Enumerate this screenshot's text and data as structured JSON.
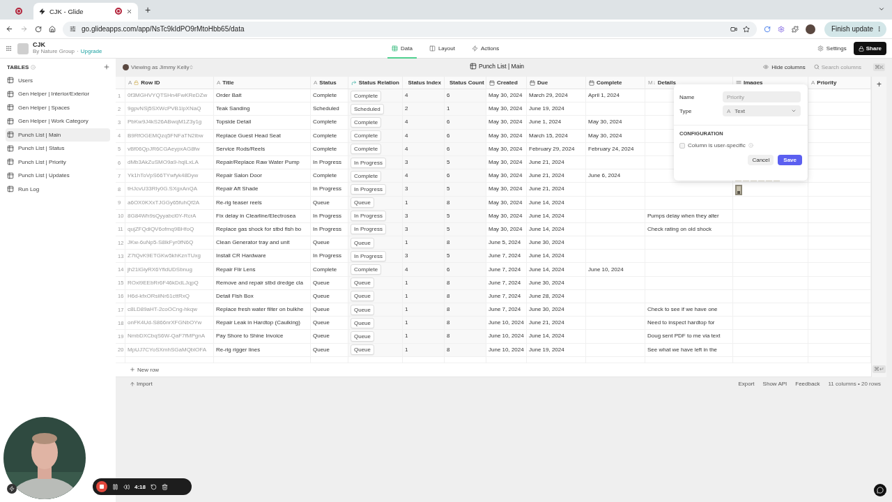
{
  "browser": {
    "tabs": [
      {
        "kind": "pinned",
        "selected": false
      },
      {
        "kind": "page",
        "title": "CJK - Glide",
        "selected": true
      }
    ],
    "new_tab": "+",
    "url": "go.glideapps.com/app/NsTc9kIdPO9rMtoHbb65/data",
    "update_button": "Finish update"
  },
  "app": {
    "name": "CJK",
    "org": "By Nature Group",
    "separator": "·",
    "upgrade": "Upgrade",
    "nav": [
      {
        "label": "Data",
        "kind": "data",
        "selected": true
      },
      {
        "label": "Layout",
        "kind": "layout",
        "selected": false
      },
      {
        "label": "Actions",
        "kind": "actions",
        "selected": false
      }
    ],
    "settings": "Settings",
    "share": "Share"
  },
  "sidebar": {
    "heading": "TABLES",
    "items": [
      {
        "label": "Users",
        "selected": false
      },
      {
        "label": "Gen Helper | Interior/Exterior",
        "selected": false
      },
      {
        "label": "Gen Helper | Spaces",
        "selected": false
      },
      {
        "label": "Gen Helper | Work Category",
        "selected": false
      },
      {
        "label": "Punch List | Main",
        "selected": true
      },
      {
        "label": "Punch List | Status",
        "selected": false
      },
      {
        "label": "Punch List | Priority",
        "selected": false
      },
      {
        "label": "Punch List | Updates",
        "selected": false
      },
      {
        "label": "Run Log",
        "selected": false
      }
    ]
  },
  "table_bar": {
    "viewing_as": "Viewing as Jimmy Kelly",
    "title": "Punch List | Main",
    "hide_columns": "Hide columns",
    "search": {
      "placeholder": "Search columns"
    },
    "shortcut": "⌘K"
  },
  "table": {
    "columns": [
      {
        "label": "Row ID",
        "kind": "rowid",
        "glyph": "A"
      },
      {
        "label": "Title",
        "kind": "text",
        "glyph": "A"
      },
      {
        "label": "Status",
        "kind": "text",
        "glyph": "A"
      },
      {
        "label": "Status Relation",
        "kind": "relation"
      },
      {
        "label": "Status Index",
        "kind": "lookup"
      },
      {
        "label": "Status Count",
        "kind": "lookup"
      },
      {
        "label": "Created",
        "kind": "date"
      },
      {
        "label": "Due",
        "kind": "date"
      },
      {
        "label": "Complete",
        "kind": "date"
      },
      {
        "label": "Details",
        "kind": "markdown",
        "glyph": "M↓"
      },
      {
        "label": "Images",
        "kind": "images"
      },
      {
        "label": "Priority",
        "kind": "text",
        "glyph": "A"
      }
    ],
    "add_column": "+",
    "rows": [
      {
        "num": "1",
        "id": "0f3MGHVYQTSHn4FwKReDZw",
        "title": "Order Bait",
        "status": "Complete",
        "relation": "Complete",
        "index": "4",
        "count": "6",
        "created": "May 30, 2024",
        "due": "March 29, 2024",
        "complete": "April 1, 2024"
      },
      {
        "num": "2",
        "id": "9gpvNSj5SXWcPVB1lpXNaQ",
        "title": "Teak Sanding",
        "status": "Scheduled",
        "relation": "Scheduled",
        "index": "2",
        "count": "1",
        "created": "May 30, 2024",
        "due": "June 19, 2024"
      },
      {
        "num": "3",
        "id": "PbKw9J4kS26ABwqM1Z3y1g",
        "title": "Topside Detail",
        "status": "Complete",
        "relation": "Complete",
        "index": "4",
        "count": "6",
        "created": "May 30, 2024",
        "due": "June 1, 2024",
        "complete": "May 30, 2024"
      },
      {
        "num": "4",
        "id": "B9RfOGEMQzq5FNFaTN2ibw",
        "title": "Replace Guest Head Seat",
        "status": "Complete",
        "relation": "Complete",
        "index": "4",
        "count": "6",
        "created": "May 30, 2024",
        "due": "March 15, 2024",
        "complete": "May 30, 2024"
      },
      {
        "num": "5",
        "id": "vBf06QpJR6CGAeypxAG8fw",
        "title": "Service Rods/Reels",
        "status": "Complete",
        "relation": "Complete",
        "index": "4",
        "count": "6",
        "created": "May 30, 2024",
        "due": "February 29, 2024",
        "complete": "February 24, 2024"
      },
      {
        "num": "6",
        "id": "dMb3AkZuSMO9a9-hqlLxLA",
        "title": "Repair/Replace Raw Water Pump",
        "status": "In Progress",
        "relation": "In Progress",
        "index": "3",
        "count": "5",
        "created": "May 30, 2024",
        "due": "June 21, 2024"
      },
      {
        "num": "7",
        "id": "Yk1hToVpS66TYwfyk48Dyw",
        "title": "Repair Salon Door",
        "status": "Complete",
        "relation": "Complete",
        "index": "4",
        "count": "6",
        "created": "May 30, 2024",
        "due": "June 21, 2024",
        "complete": "June 6, 2024"
      },
      {
        "num": "8",
        "id": "tHJcvU33RIy0G.SXgxAnQA",
        "title": "Repair Aft Shade",
        "status": "In Progress",
        "relation": "In Progress",
        "index": "3",
        "count": "5",
        "created": "May 30, 2024",
        "due": "June 21, 2024"
      },
      {
        "num": "9",
        "id": "a6OX0KXxTJGGy65fuhQf2A",
        "title": "Re-rig teaser reels",
        "status": "Queue",
        "relation": "Queue",
        "index": "1",
        "count": "8",
        "created": "May 30, 2024",
        "due": "June 14, 2024"
      },
      {
        "num": "10",
        "id": "8G84Wh9sQyyabcl0Y-RcrA",
        "title": "Fix delay in Clearline/Electrosea",
        "status": "In Progress",
        "relation": "In Progress",
        "index": "3",
        "count": "5",
        "created": "May 30, 2024",
        "due": "June 14, 2024",
        "details": "Pumps delay when they alter"
      },
      {
        "num": "11",
        "id": "qujZFQdiQV6ofmq9BHfoQ",
        "title": "Replace gas shock for stbd fish bo",
        "status": "In Progress",
        "relation": "In Progress",
        "index": "3",
        "count": "5",
        "created": "May 30, 2024",
        "due": "June 14, 2024",
        "details": "Check rating on old shock"
      },
      {
        "num": "12",
        "id": "JKw-6uNp5-S8lkFyr0fN6Q",
        "title": "Clean Generator tray and unit",
        "status": "Queue",
        "relation": "Queue",
        "index": "1",
        "count": "8",
        "created": "June 5, 2024",
        "due": "June 30, 2024"
      },
      {
        "num": "13",
        "id": "Z7tQvK9ETGKw5khKznTUxg",
        "title": "Install CR Hardware",
        "status": "In Progress",
        "relation": "In Progress",
        "index": "3",
        "count": "5",
        "created": "June 7, 2024",
        "due": "June 14, 2024"
      },
      {
        "num": "14",
        "id": "jh21lGiyRX6YfldUDSbnug",
        "title": "Repair Flir Lens",
        "status": "Complete",
        "relation": "Complete",
        "index": "4",
        "count": "6",
        "created": "June 7, 2024",
        "due": "June 14, 2024",
        "complete": "June 10, 2024"
      },
      {
        "num": "15",
        "id": "ROxl9EEbRr6F46kDdLJqpQ",
        "title": "Remove and repair stbd dredge cla",
        "status": "Queue",
        "relation": "Queue",
        "index": "1",
        "count": "8",
        "created": "June 7, 2024",
        "due": "June 30, 2024"
      },
      {
        "num": "16",
        "id": "H6d-kfxORsiiNr61cttRxQ",
        "title": "Detail Fish Box",
        "status": "Queue",
        "relation": "Queue",
        "index": "1",
        "count": "8",
        "created": "June 7, 2024",
        "due": "June 28, 2024"
      },
      {
        "num": "17",
        "id": "c8LD89aHT-2coOCng-hkqw",
        "title": "Replace fresh water filter on bulkhe",
        "status": "Queue",
        "relation": "Queue",
        "index": "1",
        "count": "8",
        "created": "June 7, 2024",
        "due": "June 30, 2024",
        "details": "Check to see if we have one"
      },
      {
        "num": "18",
        "id": "onFK4Ud-S866nrXFGNbOYw",
        "title": "Repair Leak in Hardtop (Caulking)",
        "status": "Queue",
        "relation": "Queue",
        "index": "1",
        "count": "8",
        "created": "June 10, 2024",
        "due": "June 21, 2024",
        "details": "Need to inspect hardtop for"
      },
      {
        "num": "19",
        "id": "NmbDXCbqS6W-QaF7fMPgnA",
        "title": "Pay Shore to Shine Invoice",
        "status": "Queue",
        "relation": "Queue",
        "index": "1",
        "count": "8",
        "created": "June 10, 2024",
        "due": "June 14, 2024",
        "details": "Doug sent PDF to me via text"
      },
      {
        "num": "20",
        "id": "MpUJ7CYoSXmhSGaMQblOFA",
        "title": "Re-rig rigger lines",
        "status": "Queue",
        "relation": "Queue",
        "index": "1",
        "count": "8",
        "created": "June 10, 2024",
        "due": "June 19, 2024",
        "details": "See what we have left in the"
      }
    ],
    "new_row": "New row",
    "shortcut": "⌘↵"
  },
  "column_editor": {
    "name_label": "Name",
    "name": {
      "placeholder": "Priority"
    },
    "type_label": "Type",
    "type_glyph": "A",
    "type_value": "Text",
    "section": "CONFIGURATION",
    "user_specific": {
      "label": "Column is user-specific",
      "checked": false
    },
    "cancel": "Cancel",
    "save": "Save"
  },
  "footer": {
    "import": "Import",
    "links": [
      "Export",
      "Show API",
      "Feedback"
    ],
    "summary": "11 columns • 20 rows"
  },
  "recorder": {
    "time": "4:18"
  }
}
